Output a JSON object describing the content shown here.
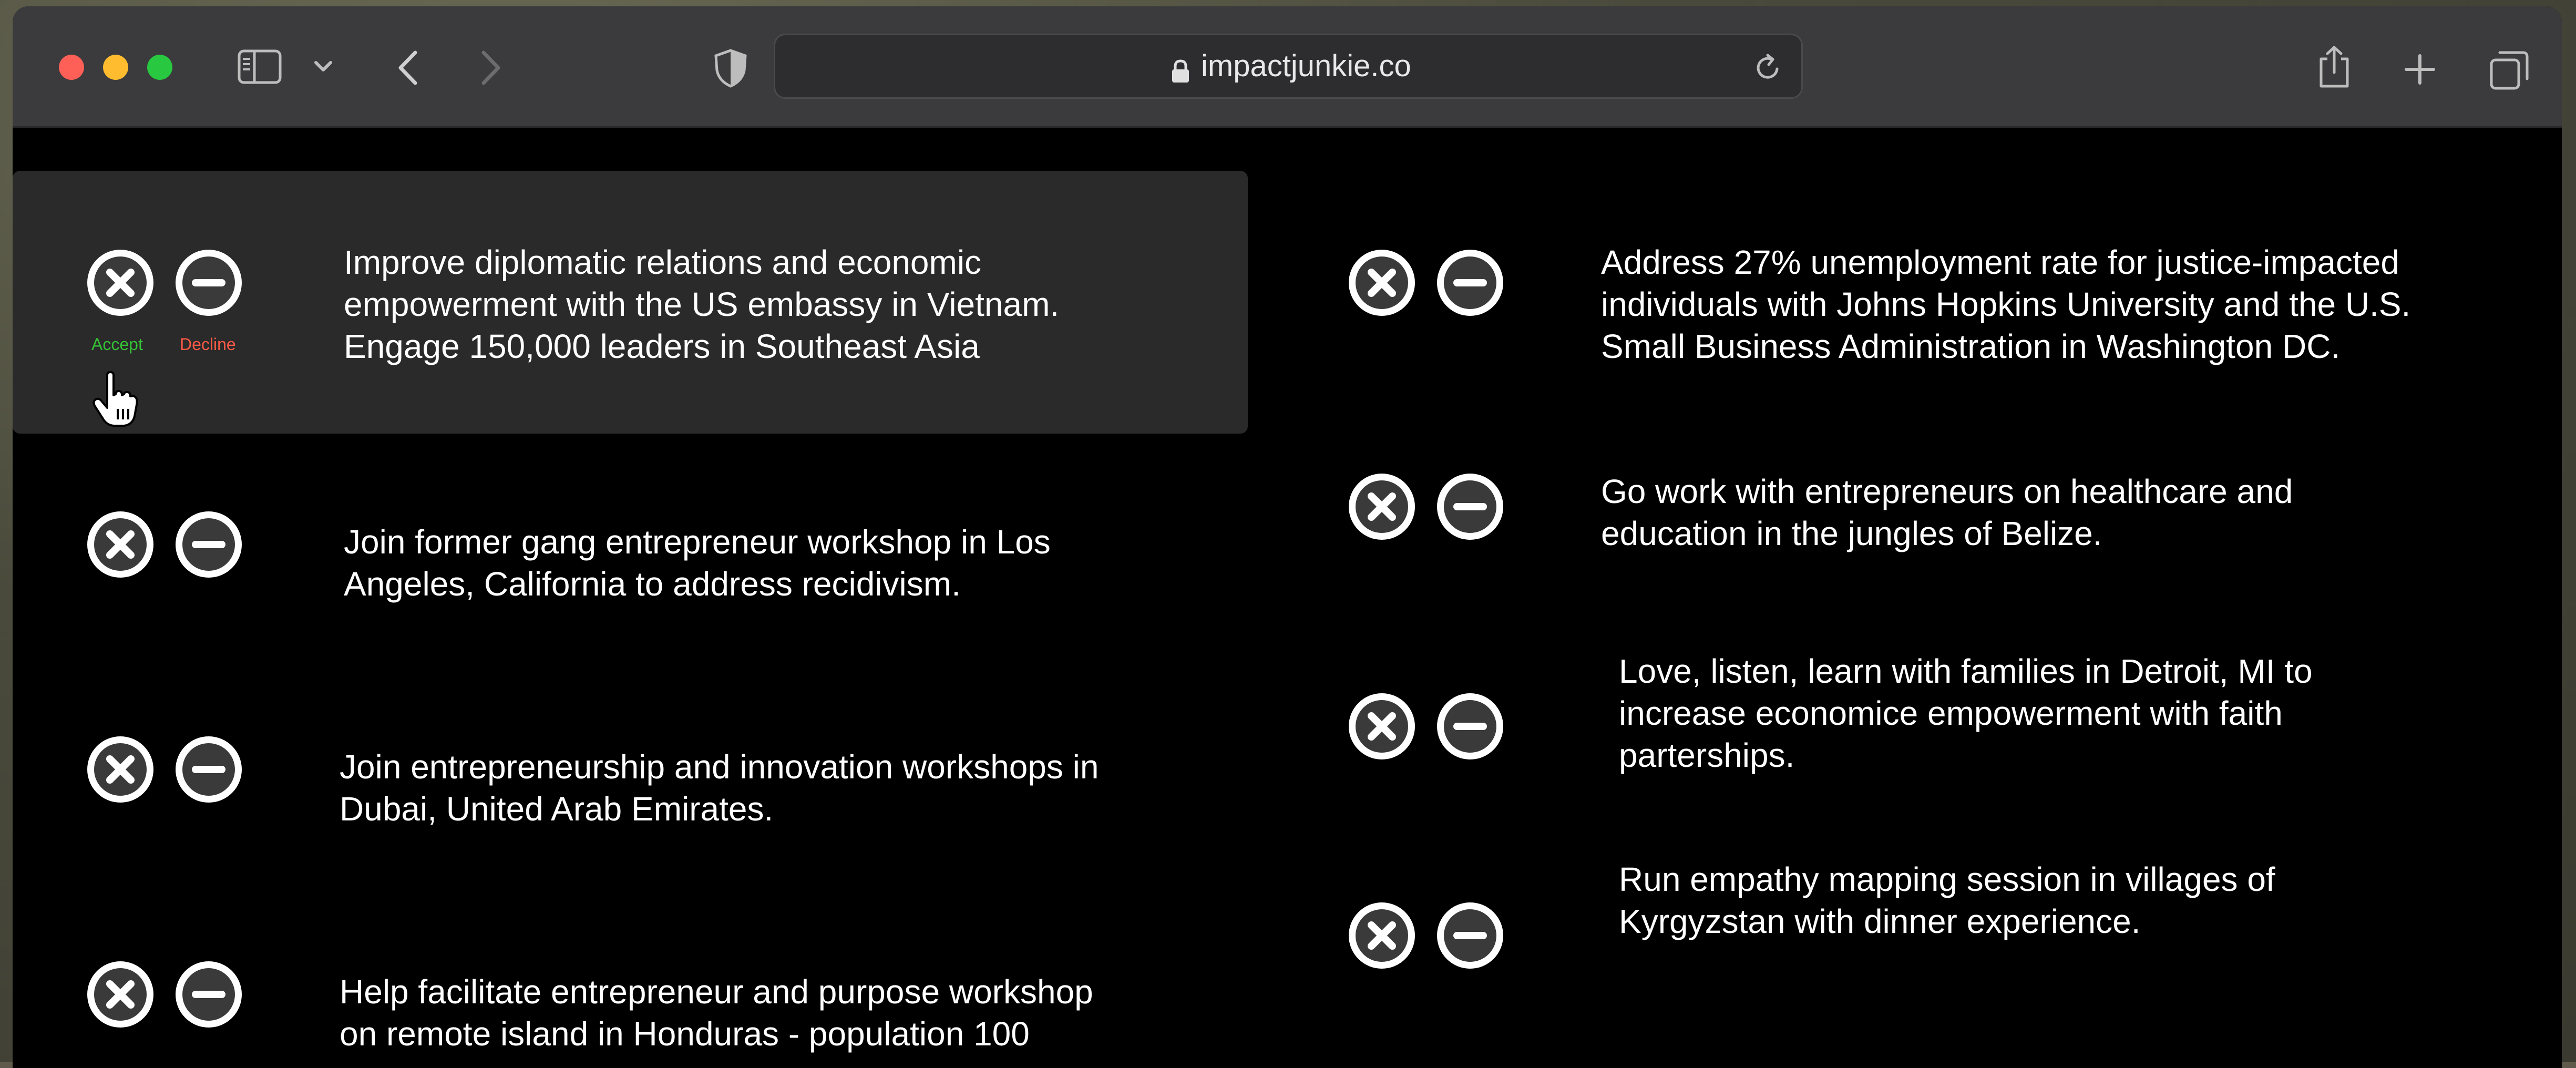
{
  "browser": {
    "url_host": "impactjunkie.co",
    "traffic_light_colors": {
      "close": "#fe5f57",
      "minimize": "#febc2e",
      "zoom": "#28c840"
    },
    "toolbar_icons": [
      "sidebar-icon",
      "chevron-down-icon",
      "back-icon",
      "forward-icon",
      "privacy-shield-icon",
      "lock-icon",
      "reload-icon",
      "share-icon",
      "new-tab-icon",
      "tab-overview-icon"
    ]
  },
  "buttons": {
    "accept_label": "Accept",
    "decline_label": "Decline",
    "accept_label_color": "#35c235",
    "decline_label_color": "#ff5a45",
    "accept_icon": "close-icon",
    "decline_icon": "minus-icon"
  },
  "opportunities": [
    {
      "text": "Improve diplomatic relations and economic\nempowerment with the US embassy in Vietnam.\nEngage 150,000 leaders in Southeast Asia",
      "highlighted": true
    },
    {
      "text": "Address 27% unemployment rate for justice-impacted\nindividuals with Johns Hopkins University and the U.S.\nSmall Business Administration in Washington DC."
    },
    {
      "text": "Join former gang entrepreneur workshop in Los\nAngeles, California to address recidivism."
    },
    {
      "text": "Go work with entrepreneurs on healthcare and\neducation in the jungles of Belize."
    },
    {
      "text": "Join entrepreneurship and innovation workshops in\nDubai, United Arab Emirates."
    },
    {
      "text": "Love, listen, learn with families in Detroit, MI to\nincrease economice empowerment with faith\nparterships."
    },
    {
      "text": "Help facilitate entrepreneur and purpose workshop\non remote island in Honduras - population 100"
    },
    {
      "text": "Run empathy mapping session in villages of\nKyrgyzstan with dinner experience."
    }
  ]
}
